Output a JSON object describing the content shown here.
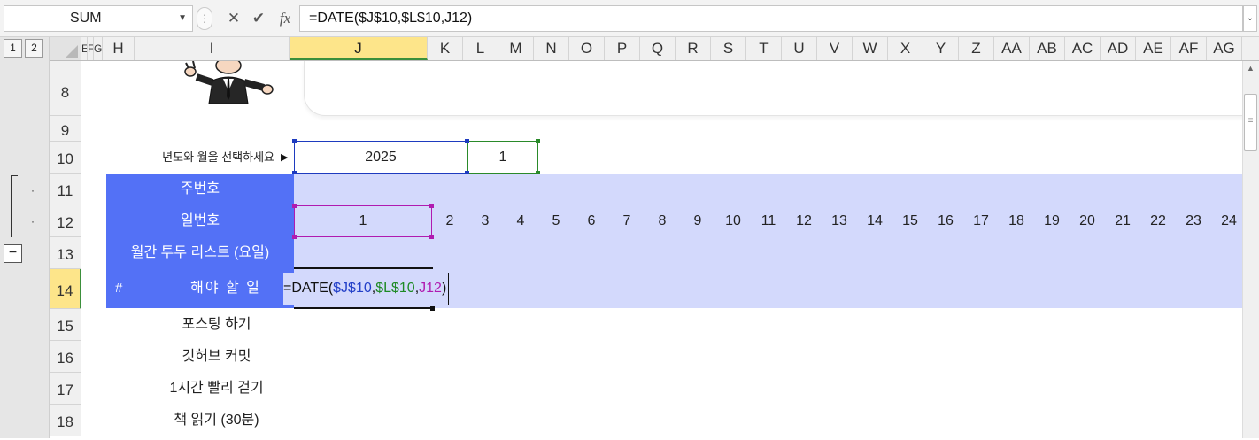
{
  "formula_bar": {
    "name_box": "SUM",
    "cancel_icon": "✕",
    "enter_icon": "✔",
    "fx_icon": "fx",
    "formula": "=DATE($J$10,$L$10,J12)"
  },
  "outline": {
    "levels": [
      "1",
      "2"
    ],
    "collapse_label": "−"
  },
  "columns": [
    "E",
    "F",
    "G",
    "H",
    "I",
    "J",
    "K",
    "L",
    "M",
    "N",
    "O",
    "P",
    "Q",
    "R",
    "S",
    "T",
    "U",
    "V",
    "W",
    "X",
    "Y",
    "Z",
    "AA",
    "AB",
    "AC",
    "AD",
    "AE",
    "AF",
    "AG"
  ],
  "selected_column": "J",
  "rows": [
    "8",
    "9",
    "10",
    "11",
    "12",
    "13",
    "14",
    "15",
    "16",
    "17",
    "18"
  ],
  "selected_row": "14",
  "sheet": {
    "prompt_label": "년도와 월을 선택하세요",
    "prompt_arrow": "▶",
    "year_value": "2025",
    "month_value": "1",
    "header_labels": {
      "week_no": "주번호",
      "day_no": "일번호",
      "monthly_todo": "월간 투두 리스트 (요일)",
      "hash": "#",
      "todo": "해야 할 일"
    },
    "day_numbers": [
      "1",
      "2",
      "3",
      "4",
      "5",
      "6",
      "7",
      "8",
      "9",
      "10",
      "11",
      "12",
      "13",
      "14",
      "15",
      "16",
      "17",
      "18",
      "19",
      "20",
      "21",
      "22",
      "23",
      "24"
    ],
    "editing_formula": {
      "prefix": "=DATE(",
      "ref1": "$J$10",
      "sep1": ",",
      "ref2": "$L$10",
      "sep2": ",",
      "ref3": "J12",
      "suffix": ")"
    },
    "tasks": [
      "포스팅 하기",
      "깃허브 커밋",
      "1시간 빨리 걷기",
      "책 읽기 (30분)"
    ]
  },
  "colors": {
    "header_blue": "#5371f6",
    "band": "#d3d9fc",
    "ref1": "#2340c8",
    "ref2": "#1d8a24",
    "ref3": "#b01bb0"
  }
}
